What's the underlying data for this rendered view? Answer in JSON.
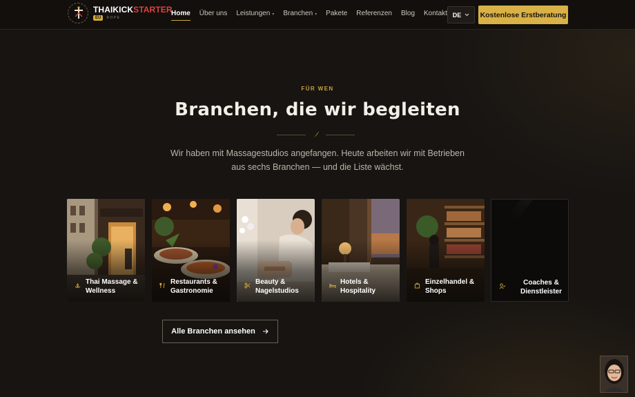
{
  "brand": {
    "name_part1": "THAIKICK",
    "name_part2": "STARTER",
    "badge": "EU",
    "sub": "ROPE",
    "accent": "#d4a93a",
    "red": "#e0413a"
  },
  "nav": {
    "items": [
      {
        "label": "Home",
        "active": true,
        "caret": false
      },
      {
        "label": "Über uns",
        "caret": false
      },
      {
        "label": "Leistungen",
        "caret": true
      },
      {
        "label": "Branchen",
        "caret": true
      },
      {
        "label": "Pakete",
        "caret": false
      },
      {
        "label": "Referenzen",
        "caret": false
      },
      {
        "label": "Blog",
        "caret": false
      },
      {
        "label": "Kontakt",
        "caret": false
      }
    ],
    "lang": "DE",
    "cta": "Kostenlose Erstberatung"
  },
  "section": {
    "eyebrow": "FÜR WEN",
    "title": "Branchen, die wir begleiten",
    "lead": "Wir haben mit Massagestudios angefangen. Heute arbeiten wir mit Betrieben aus sechs Branchen — und die Liste wächst."
  },
  "cards": [
    {
      "label": "Thai Massage & Wellness",
      "icon": "lotus-icon"
    },
    {
      "label": "Restaurants & Gastronomie",
      "icon": "cutlery-icon"
    },
    {
      "label": "Beauty & Nagelstudios",
      "icon": "scissors-icon"
    },
    {
      "label": "Hotels & Hospitality",
      "icon": "bed-icon"
    },
    {
      "label": "Einzelhandel & Shops",
      "icon": "shopping-bag-icon"
    },
    {
      "label": "Coaches & Dienstleister",
      "icon": "person-check-icon"
    }
  ],
  "all_button": {
    "label": "Alle Branchen ansehen",
    "icon": "arrow-right-icon"
  }
}
